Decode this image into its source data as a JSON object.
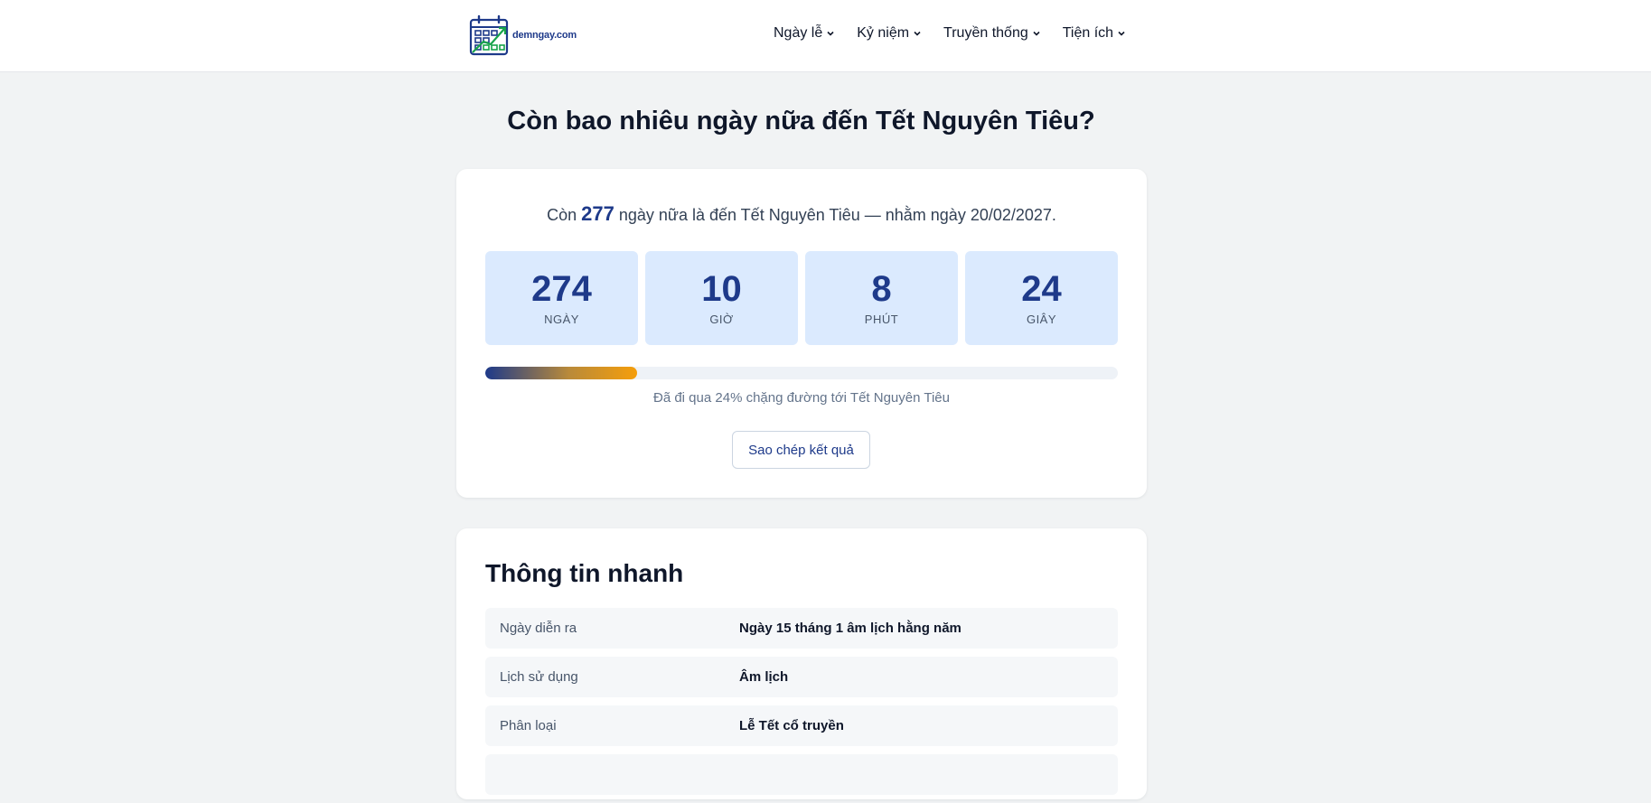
{
  "brand": {
    "name": "demngay.com"
  },
  "nav": {
    "items": [
      {
        "label": "Ngày lễ"
      },
      {
        "label": "Kỷ niệm"
      },
      {
        "label": "Truyền thống"
      },
      {
        "label": "Tiện ích"
      }
    ]
  },
  "page": {
    "title": "Còn bao nhiêu ngày nữa đến Tết Nguyên Tiêu?"
  },
  "countdown": {
    "summary_prefix": "Còn",
    "days_total": "277",
    "summary_suffix": "ngày nữa là đến Tết Nguyên Tiêu — nhằm ngày 20/02/2027.",
    "units": [
      {
        "value": "274",
        "label": "NGÀY"
      },
      {
        "value": "10",
        "label": "GIỜ"
      },
      {
        "value": "8",
        "label": "PHÚT"
      },
      {
        "value": "24",
        "label": "GIÂY"
      }
    ],
    "progress_percent": 24,
    "progress_text": "Đã đi qua 24% chặng đường tới Tết Nguyên Tiêu",
    "copy_label": "Sao chép kết quả"
  },
  "quick_info": {
    "title": "Thông tin nhanh",
    "rows": [
      {
        "label": "Ngày diễn ra",
        "value": "Ngày 15 tháng 1 âm lịch hằng năm"
      },
      {
        "label": "Lịch sử dụng",
        "value": "Âm lịch"
      },
      {
        "label": "Phân loại",
        "value": "Lễ Tết cổ truyền"
      }
    ]
  },
  "colors": {
    "accent": "#1e3a8a",
    "progress_end": "#f59e0b",
    "box_bg": "#dbeafe",
    "page_bg": "#f1f3f4"
  }
}
